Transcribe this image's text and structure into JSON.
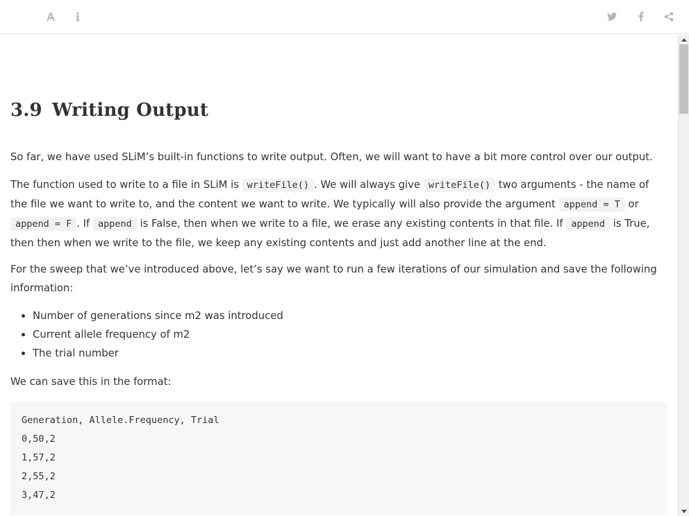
{
  "toolbar": {
    "left_icons": [
      "font-settings-icon",
      "info-icon"
    ],
    "right_icons": [
      "twitter-icon",
      "facebook-icon",
      "share-icon"
    ]
  },
  "section": {
    "number": "3.9",
    "title": "Writing Output"
  },
  "paragraphs": {
    "p1": "So far, we have used SLiM’s built-in functions to write output. Often, we will want to have a bit more control over our output.",
    "p2": {
      "t1": "The function used to write to a file in SLiM is ",
      "c1": "writeFile()",
      "t2": ". We will always give ",
      "c2": "writeFile()",
      "t3": " two arguments - the name of the file we want to write to, and the content we want to write. We typically will also provide the argument ",
      "c3": "append = T",
      "t4": " or ",
      "c4": "append = F",
      "t5": ". If ",
      "c5": "append",
      "t6": " is False, then when we write to a file, we erase any existing contents in that file. If ",
      "c6": "append",
      "t7": " is True, then then when we write to the file, we keep any existing contents and just add another line at the end."
    },
    "p3": "For the sweep that we’ve introduced above, let’s say we want to run a few iterations of our simulation and save the following information:",
    "p4": "We can save this in the format:"
  },
  "bullets": [
    "Number of generations since m2 was introduced",
    "Current allele frequency of m2",
    "The trial number"
  ],
  "code_block": [
    "Generation, Allele.Frequency, Trial",
    "0,50,2",
    "1,57,2",
    "2,55,2",
    "3,47,2"
  ],
  "colors": {
    "text": "#333333",
    "icon": "#b5b5b5",
    "code_bg": "#f7f7f7",
    "inline_code_bg": "#f2f2f2"
  }
}
